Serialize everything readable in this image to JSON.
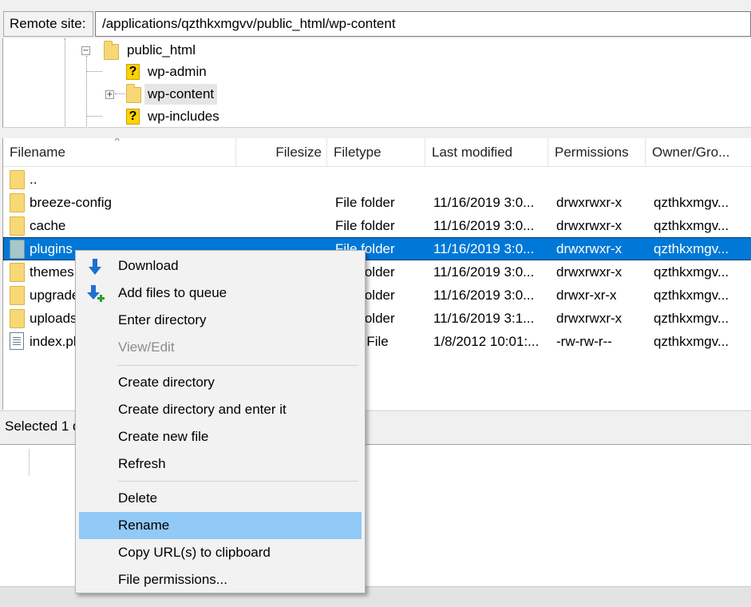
{
  "remote_site": {
    "label": "Remote site:",
    "path": "/applications/qzthkxmgvv/public_html/wp-content"
  },
  "tree": [
    {
      "name": "public_html",
      "icon": "folder-icon",
      "expander": "−"
    },
    {
      "name": "wp-admin",
      "icon": "unknown-folder-icon"
    },
    {
      "name": "wp-content",
      "icon": "folder-icon",
      "expander": "+"
    },
    {
      "name": "wp-includes",
      "icon": "unknown-folder-icon"
    }
  ],
  "columns": {
    "filename": "Filename",
    "filesize": "Filesize",
    "filetype": "Filetype",
    "last_modified": "Last modified",
    "permissions": "Permissions",
    "owner": "Owner/Gro..."
  },
  "files": [
    {
      "name": "..",
      "type": "",
      "modified": "",
      "perms": "",
      "owner": ""
    },
    {
      "name": "breeze-config",
      "type": "File folder",
      "modified": "11/16/2019 3:0...",
      "perms": "drwxrwxr-x",
      "owner": "qzthkxmgv..."
    },
    {
      "name": "cache",
      "type": "File folder",
      "modified": "11/16/2019 3:0...",
      "perms": "drwxrwxr-x",
      "owner": "qzthkxmgv..."
    },
    {
      "name": "plugins",
      "type": "File folder",
      "modified": "11/16/2019 3:0...",
      "perms": "drwxrwxr-x",
      "owner": "qzthkxmgv..."
    },
    {
      "name": "themes",
      "type": "File folder",
      "modified": "11/16/2019 3:0...",
      "perms": "drwxrwxr-x",
      "owner": "qzthkxmgv..."
    },
    {
      "name": "upgrade",
      "type": "File folder",
      "modified": "11/16/2019 3:0...",
      "perms": "drwxr-xr-x",
      "owner": "qzthkxmgv..."
    },
    {
      "name": "uploads",
      "type": "File folder",
      "modified": "11/16/2019 3:1...",
      "perms": "drwxrwxr-x",
      "owner": "qzthkxmgv..."
    },
    {
      "name": "index.php",
      "type": "PHP File",
      "modified": "1/8/2012 10:01:...",
      "perms": "-rw-rw-r--",
      "owner": "qzthkxmgv..."
    }
  ],
  "status_text": "Selected 1 directory.",
  "context_menu": {
    "download": "Download",
    "add_to_queue": "Add files to queue",
    "enter_directory": "Enter directory",
    "view_edit": "View/Edit",
    "create_directory": "Create directory",
    "create_directory_enter": "Create directory and enter it",
    "create_new_file": "Create new file",
    "refresh": "Refresh",
    "delete": "Delete",
    "rename": "Rename",
    "copy_url": "Copy URL(s) to clipboard",
    "file_permissions": "File permissions..."
  },
  "colors": {
    "selection": "#0078d7",
    "menu_hover": "#91c9f7",
    "folder": "#f8d775",
    "download_arrow": "#1e6fd0",
    "queue_plus": "#2aa12a"
  }
}
